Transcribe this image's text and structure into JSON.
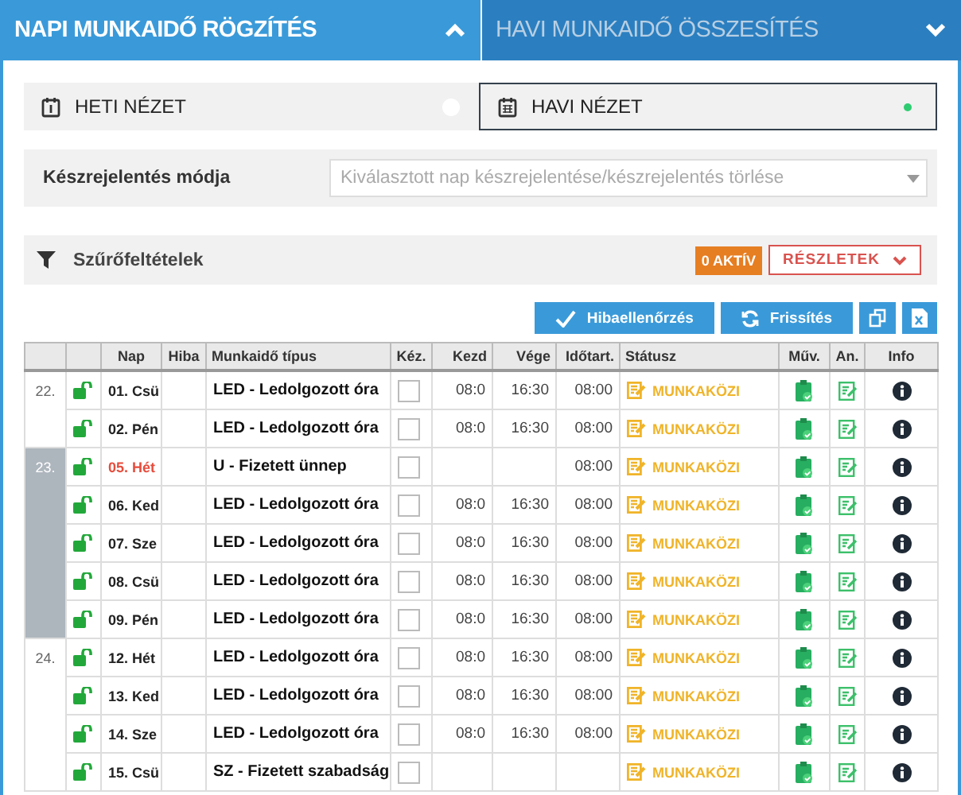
{
  "tabs": [
    {
      "label": "NAPI MUNKAIDŐ RÖGZÍTÉS",
      "selected": true,
      "expanded": true
    },
    {
      "label": "HAVI MUNKAIDŐ ÖSSZESÍTÉS",
      "selected": false,
      "expanded": false
    }
  ],
  "views": [
    {
      "label": "HETI NÉZET",
      "selected": false,
      "kind": "week"
    },
    {
      "label": "HAVI NÉZET",
      "selected": true,
      "kind": "month"
    }
  ],
  "report_mode": {
    "label": "Készrejelentés módja",
    "placeholder": "Kiválasztott nap készrejelentése/készrejelentés törlése"
  },
  "filters": {
    "label": "Szűrőfeltételek",
    "active_badge": "0 AKTÍV",
    "details_button": "RÉSZLETEK"
  },
  "toolbar": [
    {
      "label": "Hibaellenőrzés",
      "kind": "check"
    },
    {
      "label": "Frissítés",
      "kind": "refresh"
    },
    {
      "kind": "copy"
    },
    {
      "kind": "excel"
    }
  ],
  "table": {
    "columns": [
      "Nap",
      "Hiba",
      "Munkaidő típus",
      "Kéz.",
      "Kezd",
      "Vége",
      "Időtart.",
      "Státusz",
      "Műv.",
      "An.",
      "Info"
    ],
    "weeks": [
      {
        "label": "22.",
        "selected": false,
        "days": [
          {
            "day": "01. Csü",
            "holiday": false,
            "locked": false,
            "type": "LED - Ledolgozott óra",
            "manual": false,
            "start": "08:0",
            "end": "16:30",
            "duration": "08:00",
            "status": "MUNKAKÖZI"
          },
          {
            "day": "02. Pén",
            "holiday": false,
            "locked": false,
            "type": "LED - Ledolgozott óra",
            "manual": false,
            "start": "08:0",
            "end": "16:30",
            "duration": "08:00",
            "status": "MUNKAKÖZI"
          }
        ]
      },
      {
        "label": "23.",
        "selected": true,
        "days": [
          {
            "day": "05. Hét",
            "holiday": true,
            "locked": false,
            "type": "U - Fizetett ünnep",
            "manual": false,
            "duration": "08:00",
            "status": "MUNKAKÖZI"
          },
          {
            "day": "06. Ked",
            "holiday": false,
            "locked": false,
            "type": "LED - Ledolgozott óra",
            "manual": false,
            "start": "08:0",
            "end": "16:30",
            "duration": "08:00",
            "status": "MUNKAKÖZI"
          },
          {
            "day": "07. Sze",
            "holiday": false,
            "locked": false,
            "type": "LED - Ledolgozott óra",
            "manual": false,
            "start": "08:0",
            "end": "16:30",
            "duration": "08:00",
            "status": "MUNKAKÖZI"
          },
          {
            "day": "08. Csü",
            "holiday": false,
            "locked": false,
            "type": "LED - Ledolgozott óra",
            "manual": false,
            "start": "08:0",
            "end": "16:30",
            "duration": "08:00",
            "status": "MUNKAKÖZI"
          },
          {
            "day": "09. Pén",
            "holiday": false,
            "locked": false,
            "type": "LED - Ledolgozott óra",
            "manual": false,
            "start": "08:0",
            "end": "16:30",
            "duration": "08:00",
            "status": "MUNKAKÖZI"
          }
        ]
      },
      {
        "label": "24.",
        "selected": false,
        "days": [
          {
            "day": "12. Hét",
            "holiday": false,
            "locked": false,
            "type": "LED - Ledolgozott óra",
            "manual": false,
            "start": "08:0",
            "end": "16:30",
            "duration": "08:00",
            "status": "MUNKAKÖZI"
          },
          {
            "day": "13. Ked",
            "holiday": false,
            "locked": false,
            "type": "LED - Ledolgozott óra",
            "manual": false,
            "start": "08:0",
            "end": "16:30",
            "duration": "08:00",
            "status": "MUNKAKÖZI"
          },
          {
            "day": "14. Sze",
            "holiday": false,
            "locked": false,
            "type": "LED - Ledolgozott óra",
            "manual": false,
            "start": "08:0",
            "end": "16:30",
            "duration": "08:00",
            "status": "MUNKAKÖZI"
          },
          {
            "day": "15. Csü",
            "holiday": false,
            "locked": false,
            "type": "SZ - Fizetett szabadság",
            "manual": false,
            "status": "MUNKAKÖZI"
          }
        ]
      }
    ]
  }
}
